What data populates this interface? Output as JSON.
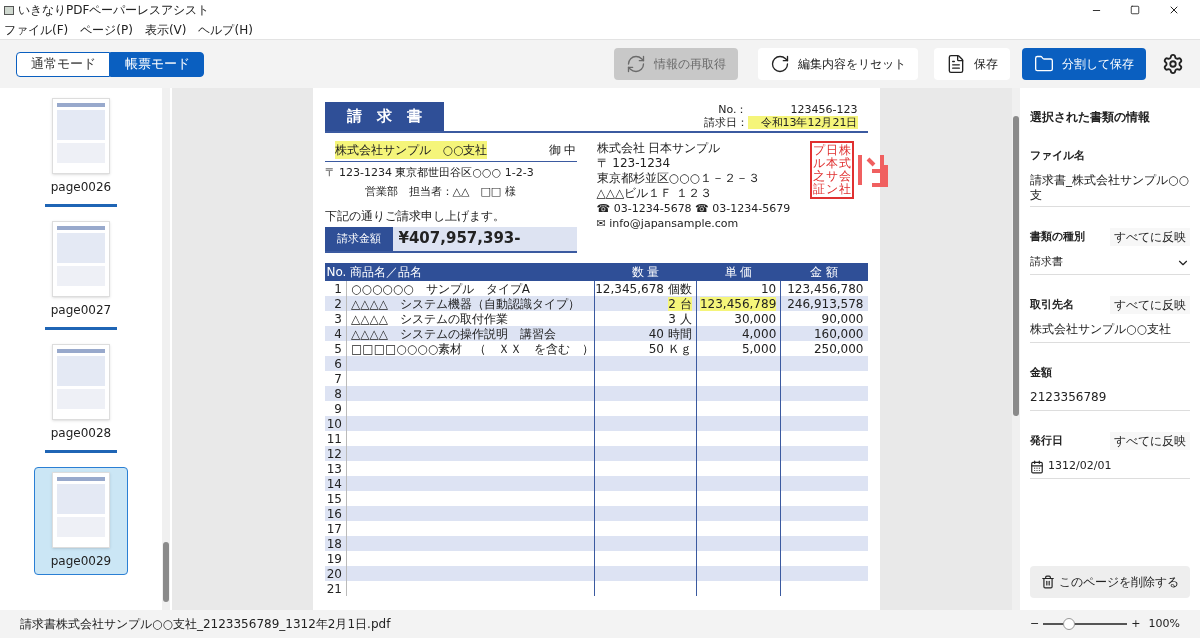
{
  "window": {
    "title": "いきなりPDFペーパーレスアシスト"
  },
  "menu": [
    "ファイル(F)",
    "ページ(P)",
    "表示(V)",
    "ヘルプ(H)"
  ],
  "modes": [
    {
      "label": "通常モード",
      "selected": false
    },
    {
      "label": "帳票モード",
      "selected": true
    }
  ],
  "toolbar": [
    {
      "label": "情報の再取得",
      "kind": "disabled"
    },
    {
      "label": "編集内容をリセット",
      "kind": "plain"
    },
    {
      "label": "保存",
      "kind": "plain"
    },
    {
      "label": "分割して保存",
      "kind": "primary"
    }
  ],
  "pages": [
    {
      "label": "page0026",
      "selected": false,
      "done": true
    },
    {
      "label": "page0027",
      "selected": false,
      "done": true
    },
    {
      "label": "page0028",
      "selected": false,
      "done": true
    },
    {
      "label": "page0029",
      "selected": true,
      "done": false
    }
  ],
  "document": {
    "title": "請　求　書",
    "meta": [
      {
        "label": "No.：",
        "value": "123456-123",
        "highlighted": false
      },
      {
        "label": "請求日：",
        "value": "令和13年12月21日",
        "highlighted": true
      }
    ],
    "client": {
      "name": "株式会社サンプル　○○支社",
      "highlighted": true,
      "suffix": "御 中",
      "address": "〒 123-1234 東京都世田谷区○○○ 1-2-3",
      "contact": "営業部　担当者：△△　□□ 様"
    },
    "greeting": "下記の通りご請求申し上げます。",
    "amount_label": "請求金額",
    "amount": "¥407,957,393-",
    "issuer": [
      "株式会社 日本サンプル",
      "〒 123-1234",
      "東京都杉並区○○○１－２－３",
      "△△△ビル１Ｆ １２３",
      "☎ 03-1234-5678  ☎ 03-1234-5679",
      "✉ info@japansample.com"
    ],
    "stamp": [
      "プル之証",
      "日本サン",
      "株式会社"
    ],
    "table": {
      "columns": [
        "No.",
        "商品名／品名",
        "数 量",
        "単 価",
        "金 額"
      ],
      "rows": [
        {
          "cells": [
            "1",
            "○○○○○○　サンプル　タイプA",
            "12,345,678 個数",
            "10",
            "123,456,780"
          ],
          "highlighted": [
            false,
            false,
            false,
            false,
            false
          ]
        },
        {
          "cells": [
            "2",
            "△△△△　システム機器（自動認識タイプ）",
            "2 台",
            "123,456,789",
            "246,913,578"
          ],
          "highlighted": [
            false,
            false,
            true,
            true,
            false
          ]
        },
        {
          "cells": [
            "3",
            "△△△△　システムの取付作業",
            "3 人",
            "30,000",
            "90,000"
          ],
          "highlighted": [
            false,
            false,
            false,
            false,
            false
          ]
        },
        {
          "cells": [
            "4",
            "△△△△　システムの操作説明　講習会",
            "40 時間",
            "4,000",
            "160,000"
          ],
          "highlighted": [
            false,
            false,
            false,
            false,
            false
          ]
        },
        {
          "cells": [
            "5",
            "□□□□○○○○素材　（　ＸＸ　を含む　）",
            "50 Ｋｇ",
            "5,000",
            "250,000"
          ],
          "highlighted": [
            false,
            false,
            false,
            false,
            false
          ]
        },
        {
          "cells": [
            "6",
            "",
            "",
            "",
            ""
          ]
        },
        {
          "cells": [
            "7",
            "",
            "",
            "",
            ""
          ]
        },
        {
          "cells": [
            "8",
            "",
            "",
            "",
            ""
          ]
        },
        {
          "cells": [
            "9",
            "",
            "",
            "",
            ""
          ]
        },
        {
          "cells": [
            "10",
            "",
            "",
            "",
            ""
          ]
        },
        {
          "cells": [
            "11",
            "",
            "",
            "",
            ""
          ]
        },
        {
          "cells": [
            "12",
            "",
            "",
            "",
            ""
          ]
        },
        {
          "cells": [
            "13",
            "",
            "",
            "",
            ""
          ]
        },
        {
          "cells": [
            "14",
            "",
            "",
            "",
            ""
          ]
        },
        {
          "cells": [
            "15",
            "",
            "",
            "",
            ""
          ]
        },
        {
          "cells": [
            "16",
            "",
            "",
            "",
            ""
          ]
        },
        {
          "cells": [
            "17",
            "",
            "",
            "",
            ""
          ]
        },
        {
          "cells": [
            "18",
            "",
            "",
            "",
            ""
          ]
        },
        {
          "cells": [
            "19",
            "",
            "",
            "",
            ""
          ]
        },
        {
          "cells": [
            "20",
            "",
            "",
            "",
            ""
          ]
        },
        {
          "cells": [
            "21",
            "",
            "",
            "",
            ""
          ]
        }
      ]
    }
  },
  "panel": {
    "title": "選択された書類の情報",
    "fields": [
      {
        "label": "ファイル名",
        "kind": "text",
        "value": "請求書_株式会社サンプル○○支"
      },
      {
        "label": "書類の種別",
        "kind": "select",
        "apply": "すべてに反映",
        "value": "請求書"
      },
      {
        "label": "取引先名",
        "kind": "text",
        "apply": "すべてに反映",
        "value": "株式会社サンプル○○支社"
      },
      {
        "label": "金額",
        "kind": "text",
        "value": "2123356789"
      },
      {
        "label": "発行日",
        "kind": "date",
        "apply": "すべてに反映",
        "value": "1312/02/01"
      }
    ],
    "delete": "このページを削除する"
  },
  "status": {
    "file": "請求書株式会社サンプル○○支社_2123356789_1312年2月1日.pdf",
    "zoom": {
      "level": 0.3,
      "minus": "−",
      "plus": "+",
      "reading": "100%"
    }
  }
}
